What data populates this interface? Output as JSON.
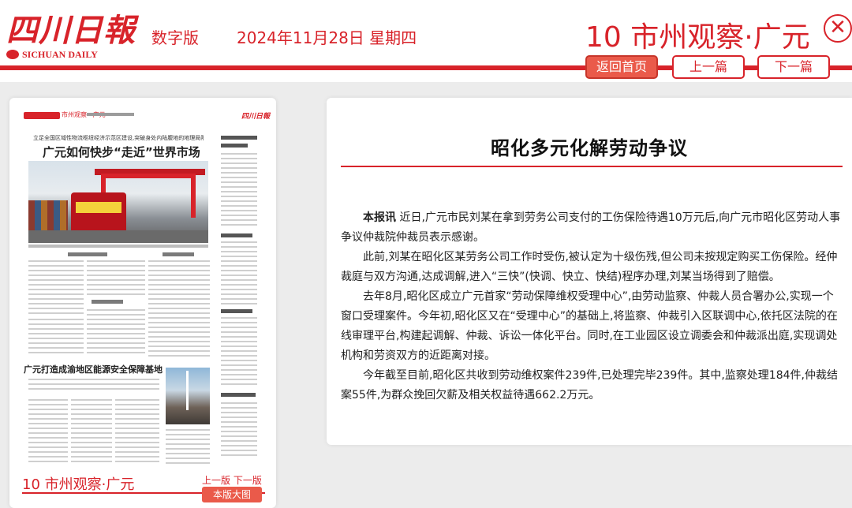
{
  "header": {
    "logo_cn": "四川日報",
    "logo_en": "SICHUAN DAILY",
    "edition_label": "数字版",
    "date": "2024年11月28日 星期四",
    "page_title": "10 市州观察·广元",
    "close_glyph": "✕",
    "nav": {
      "home": "返回首页",
      "prev": "上一篇",
      "next": "下一篇"
    }
  },
  "thumbnail": {
    "masthead_tag": "市州观察 · 广元",
    "masthead_brand": "四川日報",
    "headline_kicker": "立足全国区域性物流枢纽经济示范区建设,突破身处内陆腹地的地理局限",
    "headline": "广元如何快步“走近”世界市场",
    "second_headline": "广元打造成渝地区能源安全保障基地",
    "footer_title": "10 市州观察·广元",
    "pager_prev": "上一版",
    "pager_next": "下一版",
    "big_image_button": "本版大图"
  },
  "article": {
    "title": "昭化多元化解劳动争议",
    "lead_label": "本报讯",
    "paragraphs": [
      "近日,广元市民刘某在拿到劳务公司支付的工伤保险待遇10万元后,向广元市昭化区劳动人事争议仲裁院仲裁员表示感谢。",
      "此前,刘某在昭化区某劳务公司工作时受伤,被认定为十级伤残,但公司未按规定购买工伤保险。经仲裁庭与双方沟通,达成调解,进入“三快”(快调、快立、快结)程序办理,刘某当场得到了赔偿。",
      "去年8月,昭化区成立广元首家“劳动保障维权受理中心”,由劳动监察、仲裁人员合署办公,实现一个窗口受理案件。今年初,昭化区又在“受理中心”的基础上,将监察、仲裁引入区联调中心,依托区法院的在线审理平台,构建起调解、仲裁、诉讼一体化平台。同时,在工业园区设立调委会和仲裁派出庭,实现调处机构和劳资双方的近距离对接。",
      "今年截至目前,昭化区共收到劳动维权案件239件,已处理完毕239件。其中,监察处理184件,仲裁结案55件,为群众挽回欠薪及相关权益待遇662.2万元。"
    ]
  },
  "colors": {
    "brand_red": "#d8232a",
    "button_red": "#ea5a4a",
    "page_bg": "#ececec"
  }
}
